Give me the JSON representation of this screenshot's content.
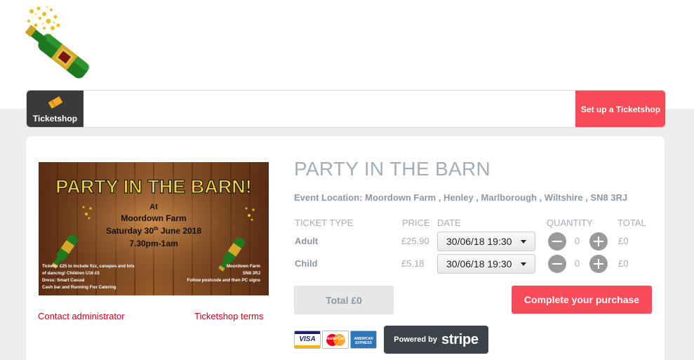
{
  "logo": {
    "icon": "champagne-bottle-icon"
  },
  "nav": {
    "ticketshop_label": "Ticketshop",
    "ticketshop_icon": "ticket-icon",
    "setup_label": "Set up a Ticketshop",
    "accent_color": "#f84a57"
  },
  "banner": {
    "title": "PARTY IN THE BARN!",
    "at": "At",
    "venue": "Moordown Farm",
    "date_prefix": "Saturday 30",
    "date_sup": "th",
    "date_suffix": " June 2018",
    "time": "7.30pm-1am",
    "info_left": [
      "Tickets: £25 to include fizz, canapes and lots",
      "of dancing! Children U16 £5",
      "Dress: Smart Casual",
      "Cash bar and Running Fox Catering"
    ],
    "info_right": [
      "Moordown Farm",
      "SN8 3RJ",
      "Follow postcode and then PC signs"
    ]
  },
  "links": {
    "contact": "Contact administrator",
    "terms": "Ticketshop terms"
  },
  "event": {
    "title": "PARTY IN THE BARN",
    "location": "Event Location: Moordown Farm , Henley , Marlborough , Wiltshire , SN8 3RJ"
  },
  "table": {
    "headers": {
      "type": "TICKET TYPE",
      "price": "PRICE",
      "date": "DATE",
      "quantity": "QUANTITY",
      "total": "TOTAL"
    },
    "rows": [
      {
        "type": "Adult",
        "price": "£25.90",
        "date": "30/06/18 19:30",
        "quantity": "0",
        "total": "£0"
      },
      {
        "type": "Child",
        "price": "£5.18",
        "date": "30/06/18 19:30",
        "quantity": "0",
        "total": "£0"
      }
    ]
  },
  "summary": {
    "total": "Total  £0",
    "complete": "Complete your purchase"
  },
  "payment": {
    "cards": [
      "VISA",
      "MasterCard",
      "AMERICAN EXPRESS"
    ],
    "powered_by": "Powered by",
    "stripe": "stripe"
  }
}
